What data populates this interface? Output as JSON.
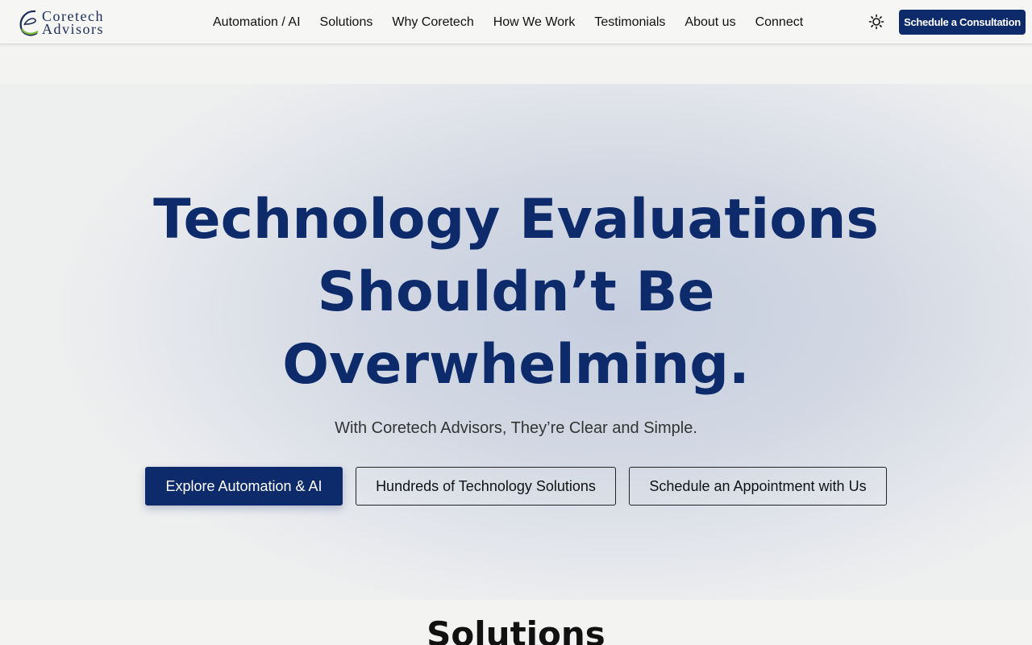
{
  "brand": {
    "line1": "Coretech",
    "line2": "Advisors",
    "colors": {
      "navy": "#0d2a6b",
      "accent_green": "#7dbb3a"
    }
  },
  "nav": {
    "items": [
      {
        "label": "Automation / AI"
      },
      {
        "label": "Solutions"
      },
      {
        "label": "Why Coretech"
      },
      {
        "label": "How We Work"
      },
      {
        "label": "Testimonials"
      },
      {
        "label": "About us"
      },
      {
        "label": "Connect"
      }
    ],
    "theme_toggle_icon": "sun-icon",
    "cta_label": "Schedule a Consultation"
  },
  "hero": {
    "title_lines": [
      "Technology Evaluations",
      "Shouldn’t Be",
      "Overwhelming."
    ],
    "subtitle": "With Coretech Advisors, They’re Clear and Simple.",
    "buttons": {
      "primary": "Explore Automation & AI",
      "secondary": "Hundreds of Technology Solutions",
      "tertiary": "Schedule an Appointment with Us"
    }
  },
  "next_section": {
    "title": "Solutions"
  }
}
